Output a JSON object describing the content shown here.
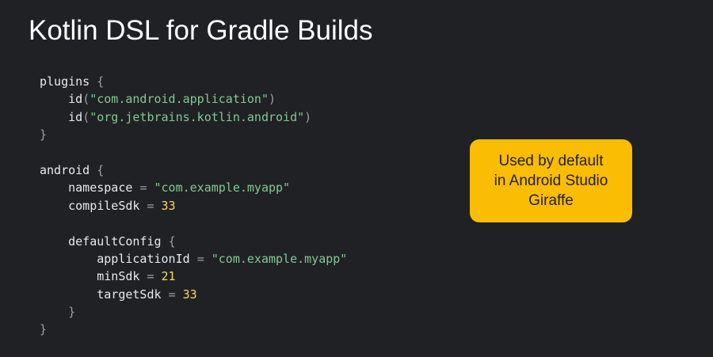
{
  "title": "Kotlin DSL for Gradle Builds",
  "callout": {
    "lines": [
      "Used by default",
      "in Android Studio",
      "Giraffe"
    ],
    "background_color": "#fbbc04"
  },
  "code": {
    "lines": [
      {
        "text": "plugins {",
        "tokens": [
          {
            "t": "plugins ",
            "k": "plain"
          },
          {
            "t": "{",
            "k": "punct"
          }
        ]
      },
      {
        "text": "    id(\"com.android.application\")",
        "tokens": [
          {
            "t": "    id",
            "k": "plain"
          },
          {
            "t": "(",
            "k": "punct"
          },
          {
            "t": "\"com.android.application\"",
            "k": "str"
          },
          {
            "t": ")",
            "k": "punct"
          }
        ]
      },
      {
        "text": "    id(\"org.jetbrains.kotlin.android\")",
        "tokens": [
          {
            "t": "    id",
            "k": "plain"
          },
          {
            "t": "(",
            "k": "punct"
          },
          {
            "t": "\"org.jetbrains.kotlin.android\"",
            "k": "str"
          },
          {
            "t": ")",
            "k": "punct"
          }
        ]
      },
      {
        "text": "}",
        "tokens": [
          {
            "t": "}",
            "k": "punct"
          }
        ]
      },
      {
        "text": "",
        "tokens": []
      },
      {
        "text": "android {",
        "tokens": [
          {
            "t": "android ",
            "k": "plain"
          },
          {
            "t": "{",
            "k": "punct"
          }
        ]
      },
      {
        "text": "    namespace = \"com.example.myapp\"",
        "tokens": [
          {
            "t": "    namespace ",
            "k": "plain"
          },
          {
            "t": "= ",
            "k": "punct"
          },
          {
            "t": "\"com.example.myapp\"",
            "k": "str"
          }
        ]
      },
      {
        "text": "    compileSdk = 33",
        "tokens": [
          {
            "t": "    compileSdk ",
            "k": "plain"
          },
          {
            "t": "= ",
            "k": "punct"
          },
          {
            "t": "33",
            "k": "num"
          }
        ]
      },
      {
        "text": "",
        "tokens": []
      },
      {
        "text": "    defaultConfig {",
        "tokens": [
          {
            "t": "    defaultConfig ",
            "k": "plain"
          },
          {
            "t": "{",
            "k": "punct"
          }
        ]
      },
      {
        "text": "        applicationId = \"com.example.myapp\"",
        "tokens": [
          {
            "t": "        applicationId ",
            "k": "plain"
          },
          {
            "t": "= ",
            "k": "punct"
          },
          {
            "t": "\"com.example.myapp\"",
            "k": "str"
          }
        ]
      },
      {
        "text": "        minSdk = 21",
        "tokens": [
          {
            "t": "        minSdk ",
            "k": "plain"
          },
          {
            "t": "= ",
            "k": "punct"
          },
          {
            "t": "21",
            "k": "num"
          }
        ]
      },
      {
        "text": "        targetSdk = 33",
        "tokens": [
          {
            "t": "        targetSdk ",
            "k": "plain"
          },
          {
            "t": "= ",
            "k": "punct"
          },
          {
            "t": "33",
            "k": "num"
          }
        ]
      },
      {
        "text": "    }",
        "tokens": [
          {
            "t": "    ",
            "k": "plain"
          },
          {
            "t": "}",
            "k": "punct"
          }
        ]
      },
      {
        "text": "}",
        "tokens": [
          {
            "t": "}",
            "k": "punct"
          }
        ]
      }
    ]
  },
  "colors": {
    "background": "#202124",
    "title": "#ffffff",
    "code_text": "#e8eaed",
    "punctuation": "#9aa0a6",
    "string": "#81c995",
    "number": "#fdd663",
    "callout_text": "#202124"
  }
}
